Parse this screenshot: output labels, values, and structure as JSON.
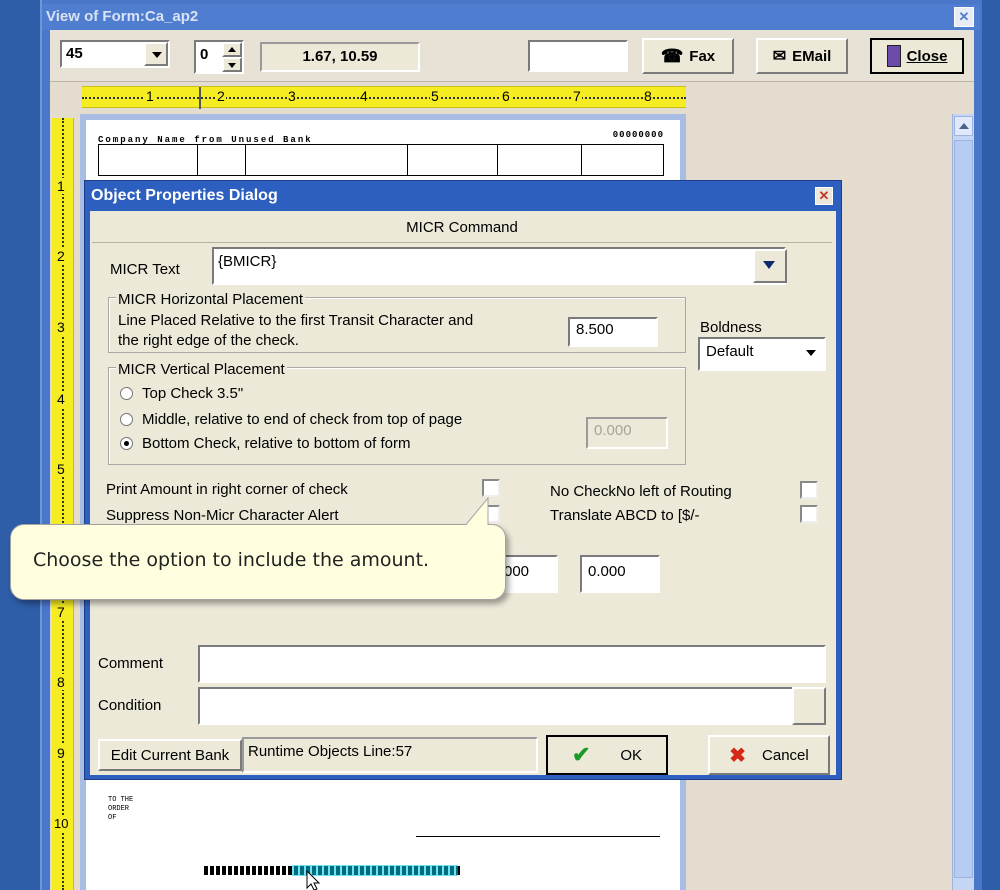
{
  "window": {
    "title": "View of Form:Ca_ap2"
  },
  "toolbar": {
    "zoom_value": "45",
    "page_value": "0",
    "coords": "1.67, 10.59",
    "fax_label": "Fax",
    "email_label": "EMail",
    "close_label": "Close"
  },
  "ruler": {
    "h_ticks": [
      "1",
      "2",
      "3",
      "4",
      "5",
      "6",
      "7",
      "8"
    ],
    "v_ticks": [
      "1",
      "2",
      "3",
      "4",
      "5",
      "6",
      "7",
      "8",
      "9",
      "10"
    ]
  },
  "form": {
    "company": "Company Name from Unused Bank",
    "check_no": "00000000",
    "pay_lines": [
      "TO THE",
      "ORDER",
      "OF"
    ]
  },
  "dialog": {
    "title": "Object Properties Dialog",
    "header": "MICR Command",
    "micr_text_label": "MICR Text",
    "micr_text_value": "{BMICR}",
    "horizontal_group": "MICR Horizontal Placement",
    "horizontal_desc_1": "Line Placed Relative to the first Transit Character and",
    "horizontal_desc_2": "the right edge of the check.",
    "horizontal_value": "8.500",
    "boldness_label": "Boldness",
    "boldness_value": "Default",
    "vertical_group": "MICR Vertical Placement",
    "radio_top": "Top Check 3.5\"",
    "radio_middle": "Middle, relative to end of check from top of page",
    "radio_bottom": "Bottom Check, relative to bottom of form",
    "vertical_value": "0.000",
    "cb_print_amount": "Print Amount in right corner of check",
    "cb_suppress": "Suppress Non-Micr Character Alert",
    "cb_no_check": "No CheckNo left of Routing",
    "cb_translate": "Translate ABCD to [$/-",
    "field_a_value": "000",
    "field_b_value": "0.000",
    "comment_label": "Comment",
    "condition_label": "Condition",
    "edit_bank_label": "Edit Current Bank",
    "status_text": "Runtime Objects  Line:57",
    "ok_label": "OK",
    "cancel_label": "Cancel"
  },
  "tooltip": {
    "text": "Choose the option to include the amount."
  }
}
